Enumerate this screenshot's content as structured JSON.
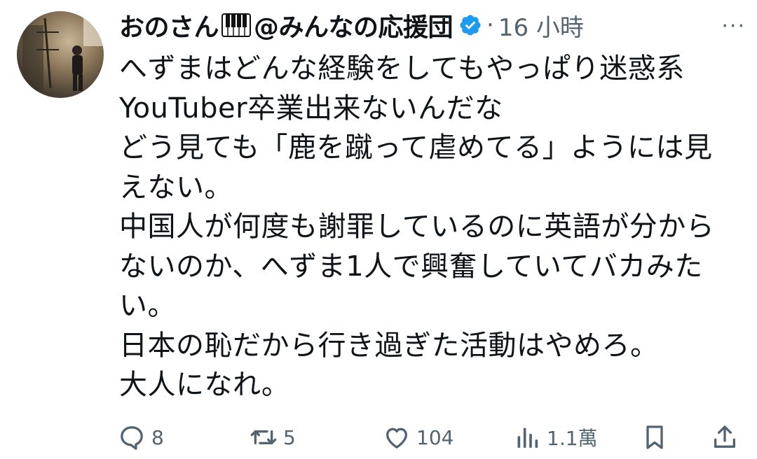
{
  "tweet": {
    "author": {
      "name_part1": "おのさん",
      "name_part2": "@みんなの応援団",
      "emoji_icon": "piano-keys-icon",
      "verified_color": "#1d9bf0"
    },
    "separator": "·",
    "time": "16 小時",
    "more_icon": "more-icon",
    "more_text": "···",
    "lines": [
      "へずまはどんな経験をしてもやっぱり迷惑系",
      "YouTuber卒業出来ないんだな",
      "どう見ても「鹿を蹴って虐めてる」ようには見",
      "えない。",
      "中国人が何度も謝罪しているのに英語が分から",
      "ないのか、へずま1人で興奮していてバカみた",
      "い。",
      "日本の恥だから行き過ぎた活動はやめろ。",
      "大人になれ。"
    ],
    "stats": {
      "replies": "8",
      "reposts": "5",
      "likes": "104",
      "views": "1.1萬"
    }
  }
}
